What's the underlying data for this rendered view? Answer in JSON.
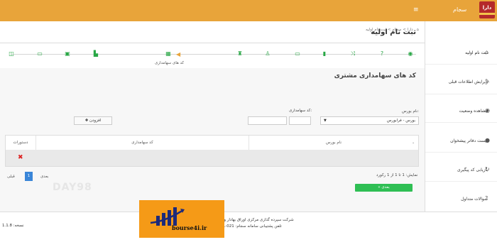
{
  "topbar": {
    "brand": "سجام",
    "logo_text": "دارا"
  },
  "breadcrumb": {
    "text": "دارا > سجام > ثبت نام اولیه"
  },
  "page": {
    "title": "ثبت نام اولیه"
  },
  "steps": {
    "active_caption": "کد های سهامداری"
  },
  "panel": {
    "title": "کد های سهامداری مشتری",
    "exchange_label": "نام بورس:",
    "exchange_value": "بورس - فرابورس",
    "code_label": "کد سهامداری:",
    "add_label": "افزودن"
  },
  "table": {
    "columns": [
      "نام بورس",
      "کد سهامداری",
      "دستورات"
    ]
  },
  "list": {
    "info": "نمایش: 1 تا 1 از 1 رکورد",
    "next_label": "« بعدی",
    "prev_label": "قبلی",
    "current_page": "1",
    "next_page_label": "بعدی"
  },
  "sidebar": {
    "items": [
      {
        "label": "ثبت نام اولیه",
        "icon": "home-icon"
      },
      {
        "label": "ویرایش اطلاعات قبلی",
        "icon": "edit-icon"
      },
      {
        "label": "مشاهده وضعیت",
        "icon": "eye-icon"
      },
      {
        "label": "لیست دفاتر پیشخوان",
        "icon": "user-icon"
      },
      {
        "label": "بازیابی کد پیگیری",
        "icon": "refresh-icon"
      },
      {
        "label": "سوالات متداول",
        "icon": "question-icon"
      }
    ]
  },
  "footer": {
    "line1": "شرکت سپرده گذاری مرکزی اوراق بهادار و تسویه وجوه",
    "line2": "تلفن پشتیبانی سامانه سجام: 021-6461",
    "version": "نسخه: 1.1.8"
  },
  "watermark": "DAY98",
  "overlay": {
    "site": "bourse4i.ir"
  },
  "colors": {
    "topbar": "#e8a43a",
    "success": "#2fbf54",
    "accent": "#3a86d8",
    "danger": "#dd2222"
  }
}
